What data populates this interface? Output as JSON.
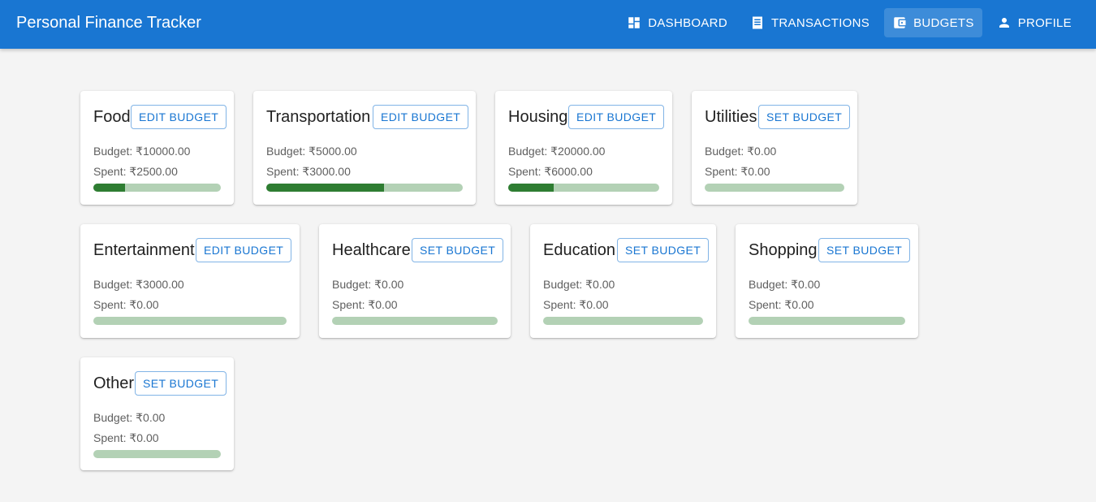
{
  "app": {
    "title": "Personal Finance Tracker",
    "accent_color": "#1976d2",
    "progress_fill_color": "#2e7d32",
    "progress_track_color": "#b3d1b5"
  },
  "nav": [
    {
      "label": "DASHBOARD",
      "icon": "dashboard-icon",
      "active": false
    },
    {
      "label": "TRANSACTIONS",
      "icon": "receipt-icon",
      "active": false
    },
    {
      "label": "BUDGETS",
      "icon": "wallet-icon",
      "active": true
    },
    {
      "label": "PROFILE",
      "icon": "person-icon",
      "active": false
    }
  ],
  "cards": [
    {
      "name": "Food",
      "button": "EDIT BUDGET",
      "budget": "Budget: ₹10000.00",
      "spent": "Spent: ₹2500.00",
      "progress": 0.25
    },
    {
      "name": "Transportation",
      "button": "EDIT BUDGET",
      "budget": "Budget: ₹5000.00",
      "spent": "Spent: ₹3000.00",
      "progress": 0.6
    },
    {
      "name": "Housing",
      "button": "EDIT BUDGET",
      "budget": "Budget: ₹20000.00",
      "spent": "Spent: ₹6000.00",
      "progress": 0.3
    },
    {
      "name": "Utilities",
      "button": "SET BUDGET",
      "budget": "Budget: ₹0.00",
      "spent": "Spent: ₹0.00",
      "progress": 0
    },
    {
      "name": "Entertainment",
      "button": "EDIT BUDGET",
      "budget": "Budget: ₹3000.00",
      "spent": "Spent: ₹0.00",
      "progress": 0
    },
    {
      "name": "Healthcare",
      "button": "SET BUDGET",
      "budget": "Budget: ₹0.00",
      "spent": "Spent: ₹0.00",
      "progress": 0
    },
    {
      "name": "Education",
      "button": "SET BUDGET",
      "budget": "Budget: ₹0.00",
      "spent": "Spent: ₹0.00",
      "progress": 0
    },
    {
      "name": "Shopping",
      "button": "SET BUDGET",
      "budget": "Budget: ₹0.00",
      "spent": "Spent: ₹0.00",
      "progress": 0
    },
    {
      "name": "Other",
      "button": "SET BUDGET",
      "budget": "Budget: ₹0.00",
      "spent": "Spent: ₹0.00",
      "progress": 0
    }
  ]
}
